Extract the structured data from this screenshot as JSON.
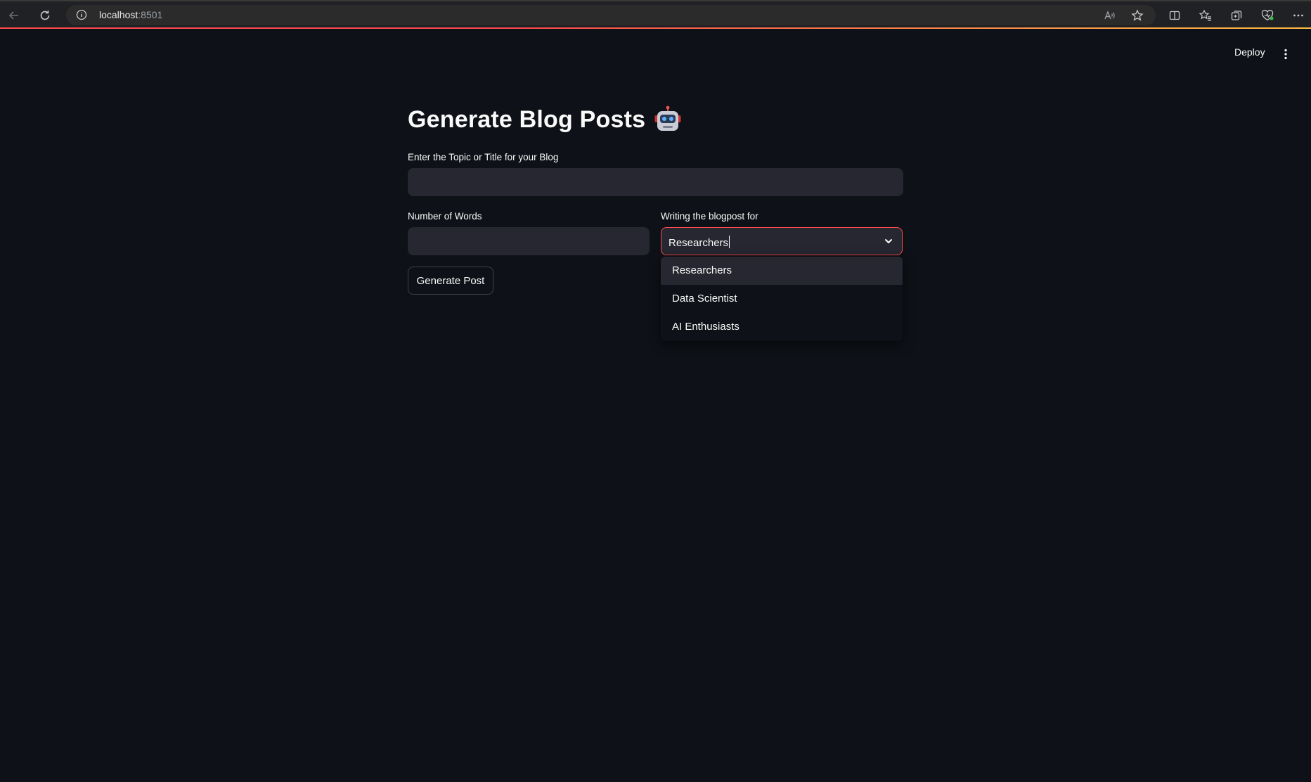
{
  "browser": {
    "url_host": "localhost",
    "url_port": ":8501"
  },
  "header": {
    "deploy_label": "Deploy"
  },
  "main": {
    "title": "Generate Blog Posts",
    "topic_label": "Enter the Topic or Title for your Blog",
    "topic_value": "",
    "words_label": "Number of Words",
    "words_value": "",
    "audience_label": "Writing the blogpost for",
    "audience_selected": "Researchers",
    "audience_options": [
      "Researchers",
      "Data Scientist",
      "AI Enthusiasts"
    ],
    "generate_label": "Generate Post"
  },
  "colors": {
    "background": "#0e1117",
    "input_bg": "#262730",
    "accent": "#ff4b4b"
  }
}
